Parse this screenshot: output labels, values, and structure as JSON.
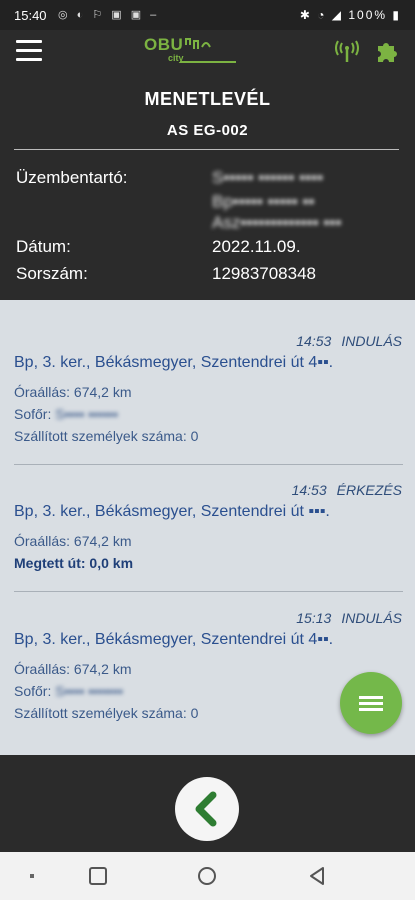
{
  "status_bar": {
    "time": "15:40",
    "left_icons": "◎ ◐ ⚐ ▣ ▣ –",
    "right_icons": "✱ ◔ ◢ 100% ▮",
    "battery": "100%"
  },
  "header": {
    "logo_text": "OBU",
    "logo_subtext": "city",
    "title": "MENETLEVÉL",
    "plate": "AS EG-002"
  },
  "info": {
    "operator_label": "Üzembentartó:",
    "operator_lines": [
      "S▪▪▪▪▪ ▪▪▪▪▪▪ ▪▪▪▪",
      "Bp▪▪▪▪▪ ▪▪▪▪▪ ▪▪",
      "Asz▪▪▪▪▪▪▪▪▪▪▪▪▪ ▪▪▪"
    ],
    "date_label": "Dátum:",
    "date_value": "2022.11.09.",
    "serial_label": "Sorszám:",
    "serial_value": "12983708348"
  },
  "entries": [
    {
      "time": "14:53",
      "type": "INDULÁS",
      "address": "Bp, 3. ker., Békásmegyer, Szentendrei út 4▪▪.",
      "odometer": "Óraállás: 674,2 km",
      "driver_label": "Sofőr:",
      "driver_value": "S▪▪▪▪ ▪▪▪▪▪▪",
      "passengers": "Szállított személyek száma: 0"
    },
    {
      "time": "14:53",
      "type": "ÉRKEZÉS",
      "address": "Bp, 3. ker., Békásmegyer, Szentendrei út ▪▪▪.",
      "odometer": "Óraállás: 674,2 km",
      "distance": "Megtett út: 0,0 km"
    },
    {
      "time": "15:13",
      "type": "INDULÁS",
      "address": "Bp, 3. ker., Békásmegyer, Szentendrei út 4▪▪.",
      "odometer": "Óraállás: 674,2 km",
      "driver_label": "Sofőr:",
      "driver_value": "S▪▪▪▪ ▪▪▪▪▪▪▪",
      "passengers": "Szállított személyek száma: 0"
    }
  ],
  "icons": {
    "menu": "hamburger-icon",
    "signal": "antenna-signal-icon",
    "settings": "puzzle-gear-icon",
    "fab": "list-icon",
    "back": "chevron-left-icon"
  },
  "colors": {
    "accent_green": "#74b84a",
    "dark_bg": "#2b2b2b",
    "list_bg": "#d9dee3",
    "link_blue": "#2a4f8f"
  }
}
